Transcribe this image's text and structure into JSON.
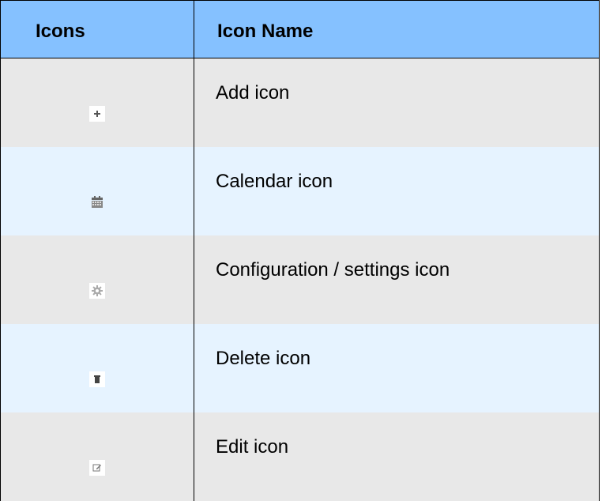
{
  "table": {
    "headers": {
      "icons": "Icons",
      "icon_name": "Icon Name"
    },
    "rows": [
      {
        "icon": "add-icon",
        "name": "Add icon"
      },
      {
        "icon": "calendar-icon",
        "name": "Calendar icon"
      },
      {
        "icon": "gear-icon",
        "name": "Configuration / settings icon"
      },
      {
        "icon": "trash-icon",
        "name": "Delete icon"
      },
      {
        "icon": "edit-icon",
        "name": "Edit icon"
      }
    ]
  },
  "colors": {
    "header_bg": "#85c1ff",
    "row_gray": "#e8e8e8",
    "row_blue": "#e6f3ff"
  }
}
